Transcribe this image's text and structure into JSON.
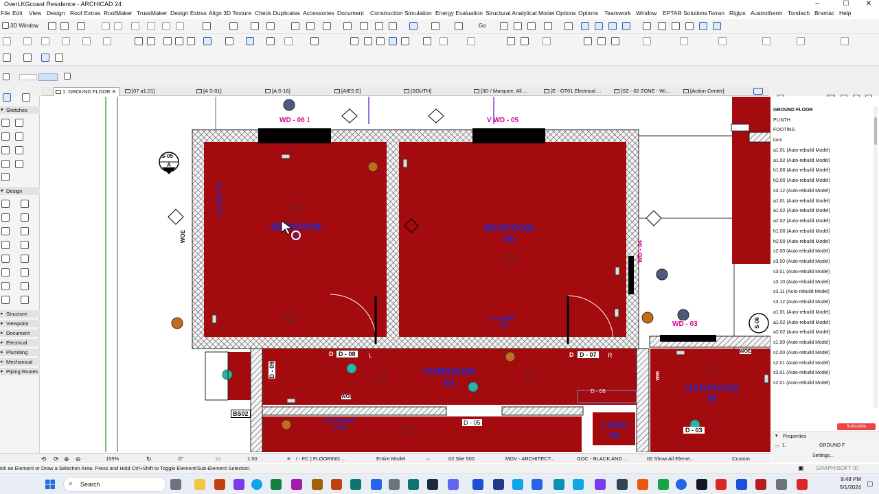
{
  "window": {
    "title": "OverLKGcoast Residence - ARCHICAD 24",
    "controls": [
      "–",
      "☐",
      "✕"
    ]
  },
  "menu": [
    "File",
    "Edit",
    "View",
    "Design",
    "Roof Extras",
    "RoofMaker",
    "TrussMaker",
    "Design Extras",
    "Align 3D Texture",
    "Check Duplicates",
    "Accessories",
    "Document",
    "Construction Simulation",
    "Energy Evaluation",
    "Structural Analytical Model Options",
    "Options",
    "Teamwork",
    "Window",
    "EPTAR Solutions",
    "Terran",
    "Rigips",
    "Austrotherm",
    "Tondach",
    "Bramac",
    "Help"
  ],
  "toolbar": {
    "view_3d_label": "3D Window",
    "go_label": "Go"
  },
  "tabs": [
    {
      "label": "1. GROUND FLOOR",
      "active": true
    },
    {
      "label": "[07 a1.01]"
    },
    {
      "label": "[A S-01]"
    },
    {
      "label": "[A S-16]"
    },
    {
      "label": "[AIES E]"
    },
    {
      "label": "[SOUTH]"
    },
    {
      "label": "[3D / Marquee, All ..."
    },
    {
      "label": "[E - GT01 Electrical ..."
    },
    {
      "label": "[SZ - 02 ZONE - Wi..."
    },
    {
      "label": "[Action Center]"
    }
  ],
  "toolbox": {
    "groups": [
      "Sketches",
      "Design",
      "Structure",
      "Viewpoint",
      "Document",
      "Electrical",
      "Plumbing",
      "Mechanical",
      "Piping Routes"
    ]
  },
  "plan": {
    "rooms": [
      {
        "name": "BEDROOM",
        "number": "0"
      },
      {
        "name": "BEDROOM",
        "number": "06"
      },
      {
        "name": "CORRIDOR",
        "number": "02"
      },
      {
        "name": "BATHROOM",
        "number": "06"
      },
      {
        "name": "CLOSET",
        "number": "07"
      },
      {
        "name": "CLOSET",
        "number": "06"
      },
      {
        "name": "TV STAND",
        "number": "LR2"
      },
      {
        "name": "LINEN",
        "number": "02"
      }
    ],
    "windows": [
      "WD - 06",
      "WD - 05",
      "WD - 04",
      "WD - 03"
    ],
    "doors": [
      "D - 08",
      "D - 07",
      "D - 09",
      "D - 06",
      "D - 05",
      "D - 03"
    ],
    "section_markers": [
      "S-05",
      "S-06"
    ],
    "section_letter": "A",
    "tags": [
      "BS02",
      "WOE",
      "WRI",
      "WOI",
      "WOE"
    ],
    "door_prefix_left": "D",
    "door_suffix_left": "L",
    "door_suffix_right": "R",
    "window_suffix": "1",
    "window_prefix": "V"
  },
  "navigator": {
    "items": [
      "GROUND FLOOR",
      "PLINTH",
      "FOOTING",
      "ions",
      "a1.01 (Auto-rebuild Model)",
      "a1.02 (Auto-rebuild Model)",
      "h1.00 (Auto-rebuild Model)",
      "h2.00 (Auto-rebuild Model)",
      "s3.12 (Auto-rebuild Model)",
      "a1.01 (Auto-rebuild Model)",
      "a1.02 (Auto-rebuild Model)",
      "a2.02 (Auto-rebuild Model)",
      "h1.00 (Auto-rebuild Model)",
      "h2.00 (Auto-rebuild Model)",
      "s2.00 (Auto-rebuild Model)",
      "s3.00 (Auto-rebuild Model)",
      "s3.01 (Auto-rebuild Model)",
      "s3.10 (Auto-rebuild Model)",
      "s3.11 (Auto-rebuild Model)",
      "s3.12 (Auto-rebuild Model)",
      "a1.01 (Auto-rebuild Model)",
      "a1.02 (Auto-rebuild Model)",
      "a2.02 (Auto-rebuild Model)",
      "s1.00 (Auto-rebuild Model)",
      "s2.00 (Auto-rebuild Model)",
      "s2.01 (Auto-rebuild Model)",
      "s3.01 (Auto-rebuild Model)",
      "s2.01 (Auto-rebuild Model)"
    ]
  },
  "properties": {
    "header": "Properties",
    "id": "1.",
    "value": "GROUND F",
    "settings": "Settings...",
    "subscribe": "Subscribe"
  },
  "bottombar": {
    "zoom": "155%",
    "angle": "0°",
    "scale": "1:50",
    "layer_combo": "I - FC | FLOORING ...",
    "model": "Entire Model",
    "site": "02 Site 500",
    "mvo": "MOV - ARCHITECT...",
    "pen": "GOC - BLACK AND ...",
    "show": "00 Show All Eleme...",
    "custom": "Custom"
  },
  "status": {
    "message": "ick an Element or Draw a Selection Area. Press and Hold Ctrl+Shift to Toggle Element/Sub-Element Selection.",
    "brand": "GRAPHISOFT ID"
  },
  "taskbar": {
    "search": "Search",
    "time": "9:48 PM",
    "date": "5/1/2024"
  },
  "colors": {
    "room_fill": "#a30b0f",
    "room_label": "#1f2ad8",
    "window_tag": "#d6008a",
    "hatch_bg": "#f4f4f4"
  }
}
